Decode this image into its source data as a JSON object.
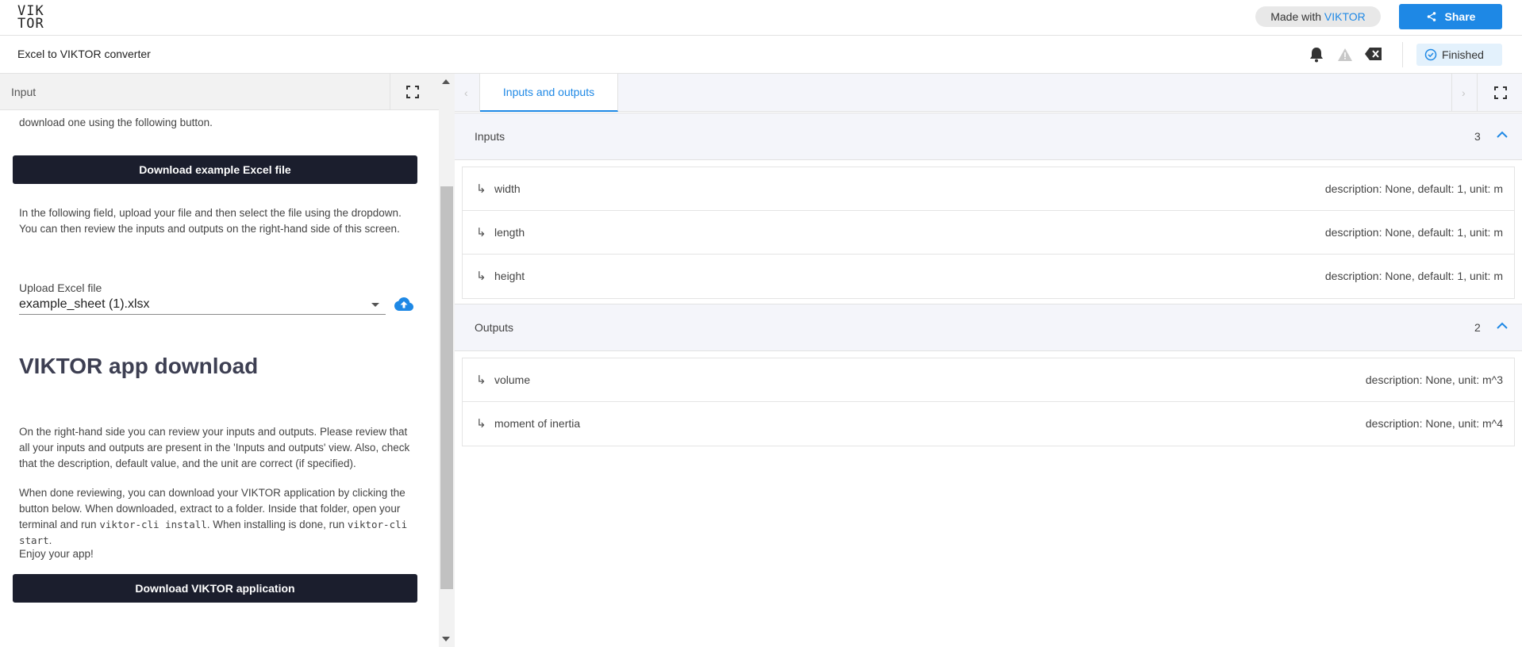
{
  "brand": {
    "logo_line1": "VIK",
    "logo_line2": "TOR",
    "made_with_prefix": "Made with",
    "made_with_brand": "VIKTOR",
    "accent": "#1e88e5"
  },
  "header": {
    "share_label": "Share",
    "app_title": "Excel to VIKTOR converter",
    "status_label": "Finished"
  },
  "left_panel": {
    "title": "Input",
    "intro_partial": "download one using the following button.",
    "download_example_label": "Download example Excel file",
    "upload_instructions": "In the following field, upload your file and then select the file using the dropdown. You can then review the inputs and outputs on the right-hand side of this screen.",
    "upload_field_label": "Upload Excel file",
    "upload_field_value": "example_sheet (1).xlsx",
    "section_heading": "VIKTOR app download",
    "review_text": "On the right-hand side you can review your inputs and outputs. Please review that all your inputs and outputs are present in the 'Inputs and outputs' view. Also, check that the description, default value, and the unit are correct (if specified).",
    "done_text_1": "When done reviewing, you can download your VIKTOR application by clicking the button below. When downloaded, extract to a folder. Inside that folder, open your terminal and run ",
    "done_code_1": "viktor-cli install",
    "done_text_2": ". When installing is done, run ",
    "done_code_2": "viktor-cli start",
    "done_text_3": ".",
    "enjoy_text": "Enjoy your app!",
    "download_app_label": "Download VIKTOR application"
  },
  "right_panel": {
    "tab_label": "Inputs and outputs",
    "inputs": {
      "title": "Inputs",
      "count": "3",
      "rows": [
        {
          "name": "width",
          "desc": "description: None, default: 1, unit: m"
        },
        {
          "name": "length",
          "desc": "description: None, default: 1, unit: m"
        },
        {
          "name": "height",
          "desc": "description: None, default: 1, unit: m"
        }
      ]
    },
    "outputs": {
      "title": "Outputs",
      "count": "2",
      "rows": [
        {
          "name": "volume",
          "desc": "description: None, unit: m^3"
        },
        {
          "name": "moment of inertia",
          "desc": "description: None, unit: m^4"
        }
      ]
    }
  },
  "icons": [
    "share-icon",
    "bell-icon",
    "warning-icon",
    "error-clear-icon",
    "check-circle-icon",
    "fullscreen-icon",
    "upload-cloud-icon",
    "chevron-up-icon",
    "sub-arrow-icon"
  ]
}
